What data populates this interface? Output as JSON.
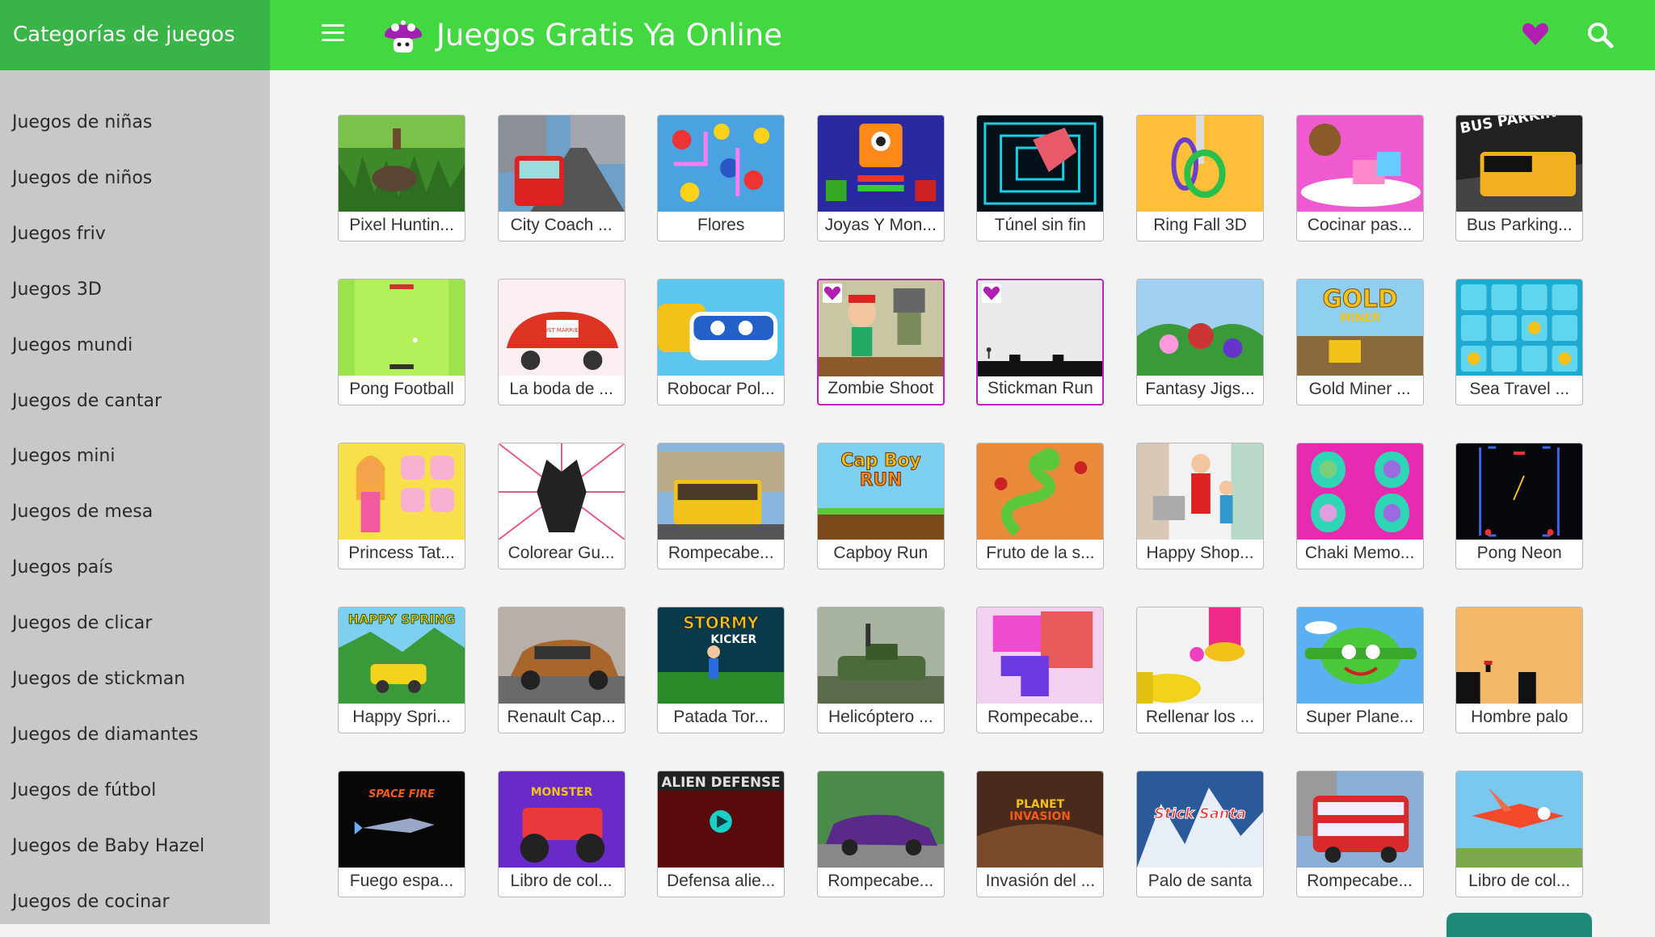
{
  "header": {
    "categories_title": "Categorías de juegos",
    "site_title": "Juegos Gratis Ya Online",
    "accent_color": "#43d742",
    "favorites_color": "#b01fb0"
  },
  "sidebar": {
    "items": [
      "Juegos de niñas",
      "Juegos de niños",
      "Juegos friv",
      "Juegos 3D",
      "Juegos mundi",
      "Juegos de cantar",
      "Juegos mini",
      "Juegos de mesa",
      "Juegos país",
      "Juegos de clicar",
      "Juegos de stickman",
      "Juegos de diamantes",
      "Juegos de fútbol",
      "Juegos de Baby Hazel",
      "Juegos de cocinar"
    ]
  },
  "games": [
    {
      "title": "Pixel Huntin...",
      "theme": "hunt",
      "favorite": false
    },
    {
      "title": "City Coach ...",
      "theme": "bus",
      "favorite": false
    },
    {
      "title": "Flores",
      "theme": "flowers",
      "favorite": false
    },
    {
      "title": "Joyas Y Mon...",
      "theme": "monster",
      "favorite": false
    },
    {
      "title": "Túnel sin fin",
      "theme": "tunnel",
      "favorite": false
    },
    {
      "title": "Ring Fall 3D",
      "theme": "rings",
      "favorite": false
    },
    {
      "title": "Cocinar pas...",
      "theme": "cake",
      "favorite": false
    },
    {
      "title": "Bus Parking...",
      "theme": "busdark",
      "favorite": false
    },
    {
      "title": "Pong Football",
      "theme": "pongfield",
      "favorite": false
    },
    {
      "title": "La boda de ...",
      "theme": "wedding",
      "favorite": false
    },
    {
      "title": "Robocar Pol...",
      "theme": "robocar",
      "favorite": false
    },
    {
      "title": "Zombie Shoot",
      "theme": "zombie",
      "favorite": true
    },
    {
      "title": "Stickman Run",
      "theme": "stickrun",
      "favorite": true
    },
    {
      "title": "Fantasy Jigs...",
      "theme": "fantasy",
      "favorite": false
    },
    {
      "title": "Gold Miner ...",
      "theme": "gold",
      "favorite": false
    },
    {
      "title": "Sea Travel ...",
      "theme": "sea",
      "favorite": false
    },
    {
      "title": "Princess Tat...",
      "theme": "princess",
      "favorite": false
    },
    {
      "title": "Colorear Gu...",
      "theme": "warrior",
      "favorite": false
    },
    {
      "title": "Rompecabe...",
      "theme": "tram",
      "favorite": false
    },
    {
      "title": "Capboy Run",
      "theme": "capboy",
      "favorite": false
    },
    {
      "title": "Fruto de la s...",
      "theme": "snake",
      "favorite": false
    },
    {
      "title": "Happy Shop...",
      "theme": "shop",
      "favorite": false
    },
    {
      "title": "Chaki Memo...",
      "theme": "chaki",
      "favorite": false
    },
    {
      "title": "Pong Neon",
      "theme": "pongneon",
      "favorite": false
    },
    {
      "title": "Happy Spri...",
      "theme": "spring",
      "favorite": false
    },
    {
      "title": "Renault Cap...",
      "theme": "car",
      "favorite": false
    },
    {
      "title": "Patada Tor...",
      "theme": "stormy",
      "favorite": false
    },
    {
      "title": "Helicóptero ...",
      "theme": "tank",
      "favorite": false
    },
    {
      "title": "Rompecabe...",
      "theme": "shapes",
      "favorite": false
    },
    {
      "title": "Rellenar los ...",
      "theme": "fill",
      "favorite": false
    },
    {
      "title": "Super Plane...",
      "theme": "plane",
      "favorite": false
    },
    {
      "title": "Hombre palo",
      "theme": "palo",
      "favorite": false
    },
    {
      "title": "Fuego espa...",
      "theme": "space",
      "favorite": false
    },
    {
      "title": "Libro de col...",
      "theme": "truck",
      "favorite": false
    },
    {
      "title": "Defensa alie...",
      "theme": "alien",
      "favorite": false
    },
    {
      "title": "Rompecabe...",
      "theme": "oldcar",
      "favorite": false
    },
    {
      "title": "Invasión del ...",
      "theme": "planet",
      "favorite": false
    },
    {
      "title": "Palo de santa",
      "theme": "santa",
      "favorite": false
    },
    {
      "title": "Rompecabe...",
      "theme": "londonbus",
      "favorite": false
    },
    {
      "title": "Libro de col...",
      "theme": "dusty",
      "favorite": false
    }
  ],
  "thumb_text": {
    "bus_parking": "BUS PARKING",
    "gold_miner": "GOLD",
    "gold_miner_sub": "MINER",
    "capboy": "Cap Boy",
    "capboy_sub": "RUN",
    "happy_spring": "HAPPY SPRING",
    "stormy": "STORMY",
    "stormy_sub": "KICKER",
    "space_fire": "SPACE FIRE",
    "alien": "ALIEN DEFENSE",
    "planet": "PLANET",
    "planet_sub": "INVASION",
    "santa": "Stick Santa",
    "wedding": "JUST MARRIED",
    "truck": "MONSTER"
  }
}
